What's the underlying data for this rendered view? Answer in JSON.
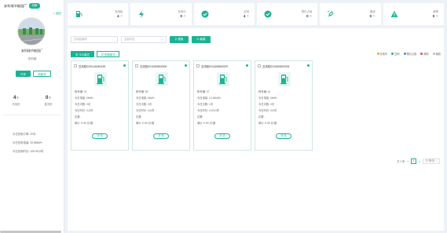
{
  "sidebar": {
    "title": "安科瑞节能园厂",
    "switch_label": "切换",
    "back_label": "< 返回",
    "station_name": "安科瑞节能园厂",
    "station_sub": "安科瑞",
    "type_tabs": [
      "汽车",
      "电瓶车"
    ],
    "stats": [
      {
        "value": "4",
        "unit": "个",
        "label": "充电桩"
      },
      {
        "value": "0",
        "unit": "个",
        "label": "直流桩"
      }
    ],
    "info": [
      "今日充电订单: 20次",
      "今日充电电量: 33.86kWh",
      "今日充电时长: 128.09小时"
    ]
  },
  "status_cards": [
    {
      "icon": "charging-pile-icon",
      "label": "充电桩",
      "count": "4",
      "unit": "个"
    },
    {
      "icon": "lightning-icon",
      "label": "充电中",
      "count": "0",
      "unit": "个"
    },
    {
      "icon": "check-circle-icon",
      "label": "空闲",
      "count": "4",
      "unit": "个"
    },
    {
      "icon": "check-circle-icon",
      "label": "预约占用",
      "count": "0",
      "unit": "个"
    },
    {
      "icon": "plug-icon",
      "label": "离线",
      "count": "0",
      "unit": "个"
    },
    {
      "icon": "warning-icon",
      "label": "故障",
      "count": "0",
      "unit": "个"
    }
  ],
  "filters": {
    "pile_placeholder": "充电桩编号",
    "status_placeholder": "全部状态",
    "search_label": "搜索",
    "refresh_label": "刷新"
  },
  "mode_tabs": [
    "卡片模式",
    "表格模式"
  ],
  "legend": [
    {
      "label": "充电中",
      "color": "#f5a623"
    },
    {
      "label": "空闲",
      "color": "#1bb394"
    },
    {
      "label": "预约占用",
      "color": "#3d8ee8"
    },
    {
      "label": "故障",
      "color": "#e74c3c"
    },
    {
      "label": "离线",
      "color": "#bbbbbb"
    }
  ],
  "cards": [
    {
      "code": "交流桩0201116060135",
      "gun": "枪号编: 21",
      "energy": "今日电量: 0kWh",
      "count": "今日次数: 0次",
      "duration": "今日时长: 0小时",
      "location": "位置:",
      "price": "单价: 0.50 元/度",
      "detail": "详 情"
    },
    {
      "code": "交流桩0211609800300",
      "gun": "枪号编: 39",
      "energy": "今日电量: 0kWh",
      "count": "今日次数: 0次",
      "duration": "今日时长: 0小时",
      "location": "位置:",
      "price": "单价: 0.50 元/度",
      "detail": "详 情"
    },
    {
      "code": "交流桩0211608800297",
      "gun": "枪号编: 27",
      "energy": "今日电量: 14.16kWh",
      "count": "今日次数: 1次",
      "duration": "今日时长: 4.20小时",
      "location": "位置:",
      "price": "单价: 0.50 元/度",
      "detail": "详 情"
    },
    {
      "code": "交流桩0211609800294",
      "gun": "枪号编: 41",
      "energy": "今日电量: 0kWh",
      "count": "今日次数: 0次",
      "duration": "今日时长: 0小时",
      "location": "位置:",
      "price": "单价: 0.50 元/度",
      "detail": "详 情"
    }
  ],
  "pager": {
    "total": "共 4 条",
    "prev": "<",
    "current": "1",
    "next": ">",
    "page_size": "12 条/页"
  }
}
